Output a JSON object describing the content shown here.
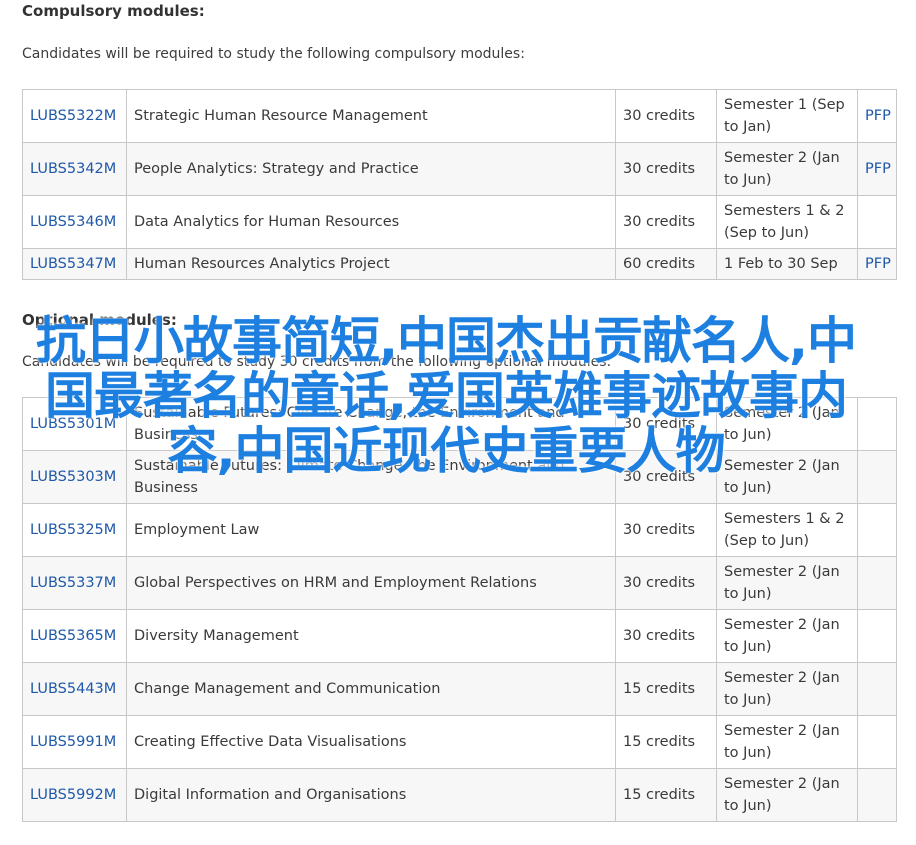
{
  "compulsory": {
    "title": "Compulsory modules:",
    "intro": "Candidates will be required to study the following compulsory modules:",
    "rows": [
      {
        "code": "LUBS5322M",
        "name": "Strategic Human Resource Management",
        "credits": "30 credits",
        "semester": "Semester 1 (Sep to Jan)",
        "pfp": "PFP"
      },
      {
        "code": "LUBS5342M",
        "name": "People Analytics: Strategy and Practice",
        "credits": "30 credits",
        "semester": "Semester 2 (Jan to Jun)",
        "pfp": "PFP"
      },
      {
        "code": "LUBS5346M",
        "name": "Data Analytics for Human Resources",
        "credits": "30 credits",
        "semester": "Semesters 1 & 2 (Sep to Jun)",
        "pfp": ""
      },
      {
        "code": "LUBS5347M",
        "name": "Human Resources Analytics Project",
        "credits": "60 credits",
        "semester": "1 Feb to 30 Sep",
        "pfp": "PFP"
      }
    ]
  },
  "optional": {
    "title": "Optional modules:",
    "intro": "Candidates will be required to study 30 credits from the following optional modules:",
    "rows": [
      {
        "code": "LUBS5301M",
        "name": "Sustainable Futures: Climate Change, the Environment and Business",
        "credits": "30 credits",
        "semester": "Semester 2 (Jan to Jun)",
        "pfp": ""
      },
      {
        "code": "LUBS5303M",
        "name": "Sustainable Futures: Climate Change, the Environment and Business",
        "credits": "30 credits",
        "semester": "Semester 2 (Jan to Jun)",
        "pfp": ""
      },
      {
        "code": "LUBS5325M",
        "name": "Employment Law",
        "credits": "30 credits",
        "semester": "Semesters 1 & 2 (Sep to Jun)",
        "pfp": ""
      },
      {
        "code": "LUBS5337M",
        "name": "Global Perspectives on HRM and Employment Relations",
        "credits": "30 credits",
        "semester": "Semester 2 (Jan to Jun)",
        "pfp": ""
      },
      {
        "code": "LUBS5365M",
        "name": "Diversity Management",
        "credits": "30 credits",
        "semester": "Semester 2 (Jan to Jun)",
        "pfp": ""
      },
      {
        "code": "LUBS5443M",
        "name": "Change Management and Communication",
        "credits": "15 credits",
        "semester": "Semester 2 (Jan to Jun)",
        "pfp": ""
      },
      {
        "code": "LUBS5991M",
        "name": "Creating Effective Data Visualisations",
        "credits": "15 credits",
        "semester": "Semester 2 (Jan to Jun)",
        "pfp": ""
      },
      {
        "code": "LUBS5992M",
        "name": "Digital Information and Organisations",
        "credits": "15 credits",
        "semester": "Semester 2 (Jan to Jun)",
        "pfp": ""
      }
    ]
  },
  "overlay": {
    "text": "抗日小故事简短,中国杰出贡献名人,中国最著名的童话,爱国英雄事迹故事内容,中国近现代史重要人物",
    "color": "#1d7fe0"
  }
}
